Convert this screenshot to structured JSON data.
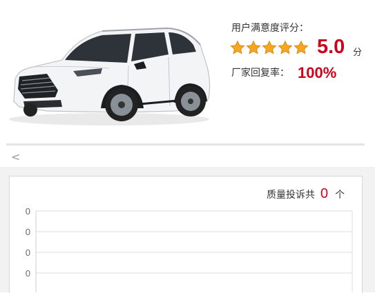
{
  "product": {
    "image_alt": "白色SUV",
    "colors": {
      "body": "#f4f5f6",
      "window": "#2c3138",
      "trim": "#1b1d20"
    }
  },
  "rating": {
    "label": "用户满意度评分：",
    "star_count": 5,
    "stars_filled": 5,
    "score": "5.0",
    "unit": "分"
  },
  "reply": {
    "label": "厂家回复率：",
    "value": "100%"
  },
  "nav": {
    "back_label": "<"
  },
  "complaints": {
    "prefix": "质量投诉共",
    "count": "0",
    "suffix": "个"
  },
  "colors": {
    "accent": "#d0021b",
    "star": "#f5a623",
    "gridline": "#dddddd"
  },
  "chart_data": {
    "type": "bar",
    "categories": [],
    "values": [],
    "y_ticks": [
      "0",
      "0",
      "0",
      "0"
    ],
    "grid": true
  }
}
